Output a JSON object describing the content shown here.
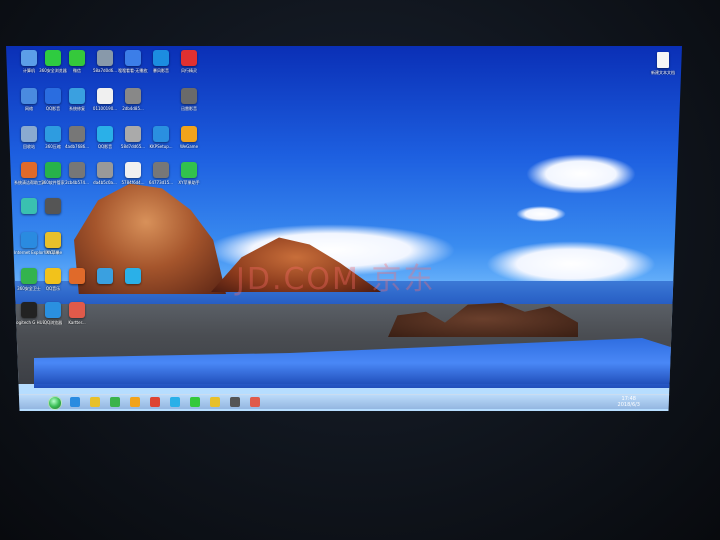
{
  "desktop": {
    "watermark": "JD.COM 京东",
    "icons": [
      {
        "label": "计算机",
        "color": "#5c9ee8",
        "col": 0,
        "row": 0
      },
      {
        "label": "360安全浏览器",
        "color": "#2ecc40",
        "col": 1,
        "row": 0
      },
      {
        "label": "微信",
        "color": "#35c93b",
        "col": 2,
        "row": 0
      },
      {
        "label": "58a7d0d6...",
        "color": "#8899aa",
        "col": 3,
        "row": 0
      },
      {
        "label": "嗖嗖看看·无播放大片",
        "color": "#3c7ee8",
        "col": 4,
        "row": 0
      },
      {
        "label": "暴风影音",
        "color": "#1c8de0",
        "col": 5,
        "row": 0
      },
      {
        "label": "风行精灵",
        "color": "#e03030",
        "col": 6,
        "row": 0
      },
      {
        "label": "网络",
        "color": "#4a8be0",
        "col": 0,
        "row": 1
      },
      {
        "label": "QQ影音",
        "color": "#2a6de0",
        "col": 1,
        "row": 1
      },
      {
        "label": "系统修复",
        "color": "#3aa0e0",
        "col": 2,
        "row": 1
      },
      {
        "label": "01100190...",
        "color": "#f0f0f0",
        "col": 3,
        "row": 1
      },
      {
        "label": "2db4d85...",
        "color": "#888888",
        "col": 4,
        "row": 1
      },
      {
        "label": "迅雷影音",
        "color": "#6a6a6a",
        "col": 6,
        "row": 1
      },
      {
        "label": "回收站",
        "color": "#8aaad0",
        "col": 0,
        "row": 2
      },
      {
        "label": "360压缩",
        "color": "#2e9ce0",
        "col": 1,
        "row": 2
      },
      {
        "label": "4adb7686...",
        "color": "#777777",
        "col": 2,
        "row": 2
      },
      {
        "label": "QQ影音",
        "color": "#2ab0e8",
        "col": 3,
        "row": 2
      },
      {
        "label": "58d7dd65...",
        "color": "#aaaaaa",
        "col": 4,
        "row": 2
      },
      {
        "label": "KKPSetup...",
        "color": "#2a90e0",
        "col": 5,
        "row": 2
      },
      {
        "label": "WeGame",
        "color": "#f2a31b",
        "col": 6,
        "row": 2
      },
      {
        "label": "系统清洁帮助工具",
        "color": "#e06a2a",
        "col": 0,
        "row": 3
      },
      {
        "label": "360软件管家",
        "color": "#27b34a",
        "col": 1,
        "row": 3
      },
      {
        "label": "2cb4b574...",
        "color": "#777777",
        "col": 2,
        "row": 3
      },
      {
        "label": "da4b5c0a...",
        "color": "#999999",
        "col": 3,
        "row": 3
      },
      {
        "label": "5784f6d4...",
        "color": "#f0f0f0",
        "col": 4,
        "row": 3
      },
      {
        "label": "64773d15...",
        "color": "#777777",
        "col": 5,
        "row": 3
      },
      {
        "label": "XY苹果助手",
        "color": "#32c24d",
        "col": 6,
        "row": 3
      },
      {
        "label": "",
        "color": "#3ac0b0",
        "col": 0,
        "row": 4
      },
      {
        "label": "",
        "color": "#555555",
        "col": 1,
        "row": 4
      },
      {
        "label": "WeGame",
        "color": "#f2a31b",
        "col": 1,
        "row": 5
      },
      {
        "label": "Internet Explorer",
        "color": "#2a8be0",
        "col": 0,
        "row": 5
      },
      {
        "label": "XY苹果",
        "color": "#e8c02a",
        "col": 1,
        "row": 5
      },
      {
        "label": "360安全卫士",
        "color": "#33b34d",
        "col": 0,
        "row": 6
      },
      {
        "label": "QQ音乐",
        "color": "#f2c21b",
        "col": 1,
        "row": 6
      },
      {
        "label": "",
        "color": "#e06a2a",
        "col": 2,
        "row": 6
      },
      {
        "label": "",
        "color": "#3aa0e0",
        "col": 3,
        "row": 6
      },
      {
        "label": "",
        "color": "#2ab0e8",
        "col": 4,
        "row": 6
      },
      {
        "label": "Logitech G HUB",
        "color": "#222222",
        "col": 0,
        "row": 7
      },
      {
        "label": "QQ浏览器",
        "color": "#2a90e0",
        "col": 1,
        "row": 7
      },
      {
        "label": "Kartter...",
        "color": "#e05a4a",
        "col": 2,
        "row": 7
      }
    ],
    "right_icon": {
      "label": "新建文本文档",
      "color": "#f6f6f6"
    }
  },
  "taskbar": {
    "apps": [
      {
        "name": "ie",
        "color": "#2a8be0"
      },
      {
        "name": "explorer",
        "color": "#e8c02a"
      },
      {
        "name": "360",
        "color": "#3ab34a"
      },
      {
        "name": "media",
        "color": "#f2a31b"
      },
      {
        "name": "chrome",
        "color": "#dd4433"
      },
      {
        "name": "qq",
        "color": "#2ab0e8"
      },
      {
        "name": "wechat",
        "color": "#35c93b"
      },
      {
        "name": "folder",
        "color": "#e8c02a"
      },
      {
        "name": "game",
        "color": "#555555"
      },
      {
        "name": "player",
        "color": "#e05a4a"
      }
    ],
    "clock_time": "17:48",
    "clock_date": "2018/6/3"
  }
}
